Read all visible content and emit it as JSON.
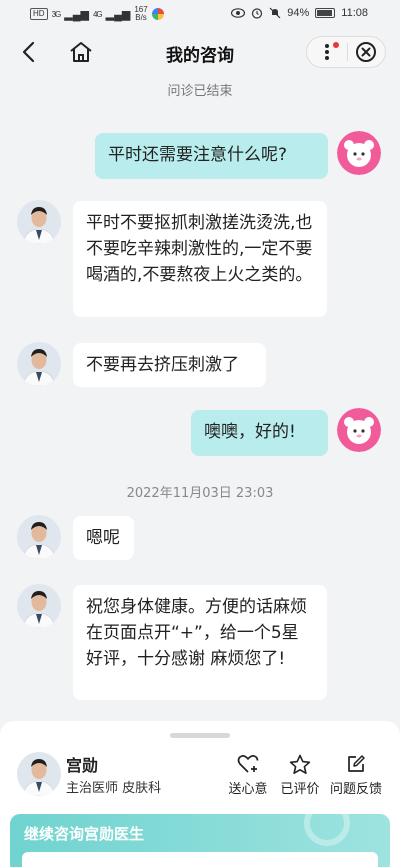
{
  "status_bar": {
    "hd_badge": "HD",
    "net1": "3G",
    "net2": "4G",
    "speed": "167",
    "speed_unit": "B/s",
    "battery": "94%",
    "time": "11:08"
  },
  "header": {
    "title": "我的咨询"
  },
  "consult_status": "问诊已结束",
  "messages": [
    {
      "from": "patient",
      "text": "平时还需要注意什么呢?"
    },
    {
      "from": "doctor",
      "text": "平时不要抠抓刺激搓洗烫洗,也不要吃辛辣刺激性的,一定不要喝酒的,不要熬夜上火之类的。"
    },
    {
      "from": "doctor",
      "text": "不要再去挤压刺激了"
    },
    {
      "from": "patient",
      "text": "噢噢，好的!"
    },
    {
      "from": "doctor",
      "text": "嗯呢"
    },
    {
      "from": "doctor",
      "text": "祝您身体健康。方便的话麻烦在页面点开“+”，给一个5星好评，十分感谢  麻烦您了!"
    }
  ],
  "timestamp": "2022年11月03日 23:03",
  "doctor_panel": {
    "name": "宫勋",
    "title": "主治医师 皮肤科",
    "actions": {
      "gift": "送心意",
      "review": "已评价",
      "feedback": "问题反馈"
    },
    "continue_label": "继续咨询宫勋医生"
  },
  "colors": {
    "patient_bubble": "#b9ecec",
    "doctor_bubble": "#ffffff",
    "background": "#f2f3f5",
    "accent_teal": "#6fd3cf",
    "notify_dot": "#e53935"
  }
}
